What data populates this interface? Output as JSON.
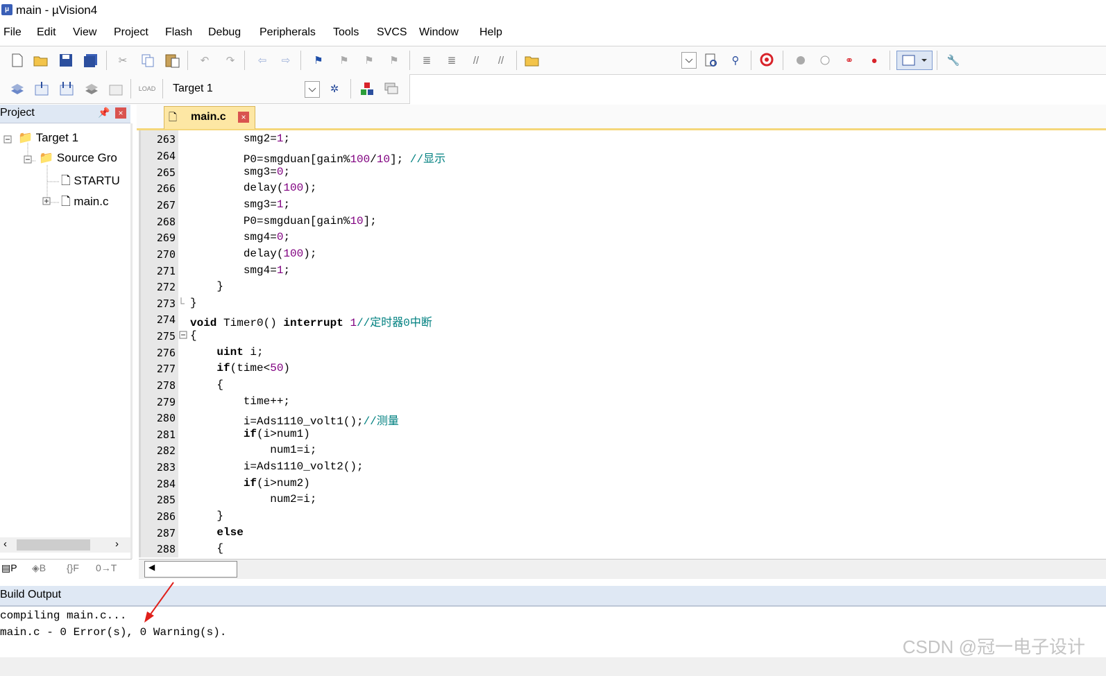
{
  "window": {
    "title": "main  - µVision4"
  },
  "menu": [
    "File",
    "Edit",
    "View",
    "Project",
    "Flash",
    "Debug",
    "Peripherals",
    "Tools",
    "SVCS",
    "Window",
    "Help"
  ],
  "toolbar2": {
    "target_select": "Target 1"
  },
  "project": {
    "header": "Project",
    "tree": [
      "Target 1",
      "Source Gro",
      "STARTU",
      "main.c"
    ],
    "tabs": [
      "P",
      "B",
      "F",
      "T"
    ]
  },
  "editor": {
    "tab": "main.c",
    "lines": [
      {
        "n": "263",
        "t": "        smg2=",
        "num": "1",
        ";": "",
        "rest": ";"
      },
      {
        "n": "264"
      },
      {
        "n": "265"
      },
      {
        "n": "266"
      },
      {
        "n": "267"
      },
      {
        "n": "268"
      },
      {
        "n": "269"
      },
      {
        "n": "270"
      },
      {
        "n": "271"
      },
      {
        "n": "272"
      },
      {
        "n": "273"
      },
      {
        "n": "274"
      },
      {
        "n": "275"
      },
      {
        "n": "276"
      },
      {
        "n": "277"
      },
      {
        "n": "278"
      },
      {
        "n": "279"
      },
      {
        "n": "280"
      },
      {
        "n": "281"
      },
      {
        "n": "282"
      },
      {
        "n": "283"
      },
      {
        "n": "284"
      },
      {
        "n": "285"
      },
      {
        "n": "286"
      },
      {
        "n": "287"
      },
      {
        "n": "288"
      }
    ],
    "code_text": [
      "        smg2=1;",
      "        P0=smgduan[gain%100/10]; //显示",
      "        smg3=0;",
      "        delay(100);",
      "        smg3=1;",
      "        P0=smgduan[gain%10];",
      "        smg4=0;",
      "        delay(100);",
      "        smg4=1;",
      "    }",
      "}",
      "void Timer0() interrupt 1//定时器0中断",
      "{",
      "    uint i;",
      "    if(time<50)",
      "    {",
      "        time++;",
      "        i=Ads1110_volt1();//测量",
      "        if(i>num1)",
      "            num1=i;",
      "        i=Ads1110_volt2();",
      "        if(i>num2)",
      "            num2=i;",
      "    }",
      "    else",
      "    {"
    ]
  },
  "build": {
    "header": "Build Output",
    "lines": [
      "compiling main.c...",
      "main.c - 0 Error(s), 0 Warning(s)."
    ]
  },
  "watermark": "CSDN @冠一电子设计",
  "colors": {
    "panel_header": "#dfe8f4",
    "tab_active": "#fde7a4",
    "comment": "#008080",
    "number": "#800080"
  }
}
